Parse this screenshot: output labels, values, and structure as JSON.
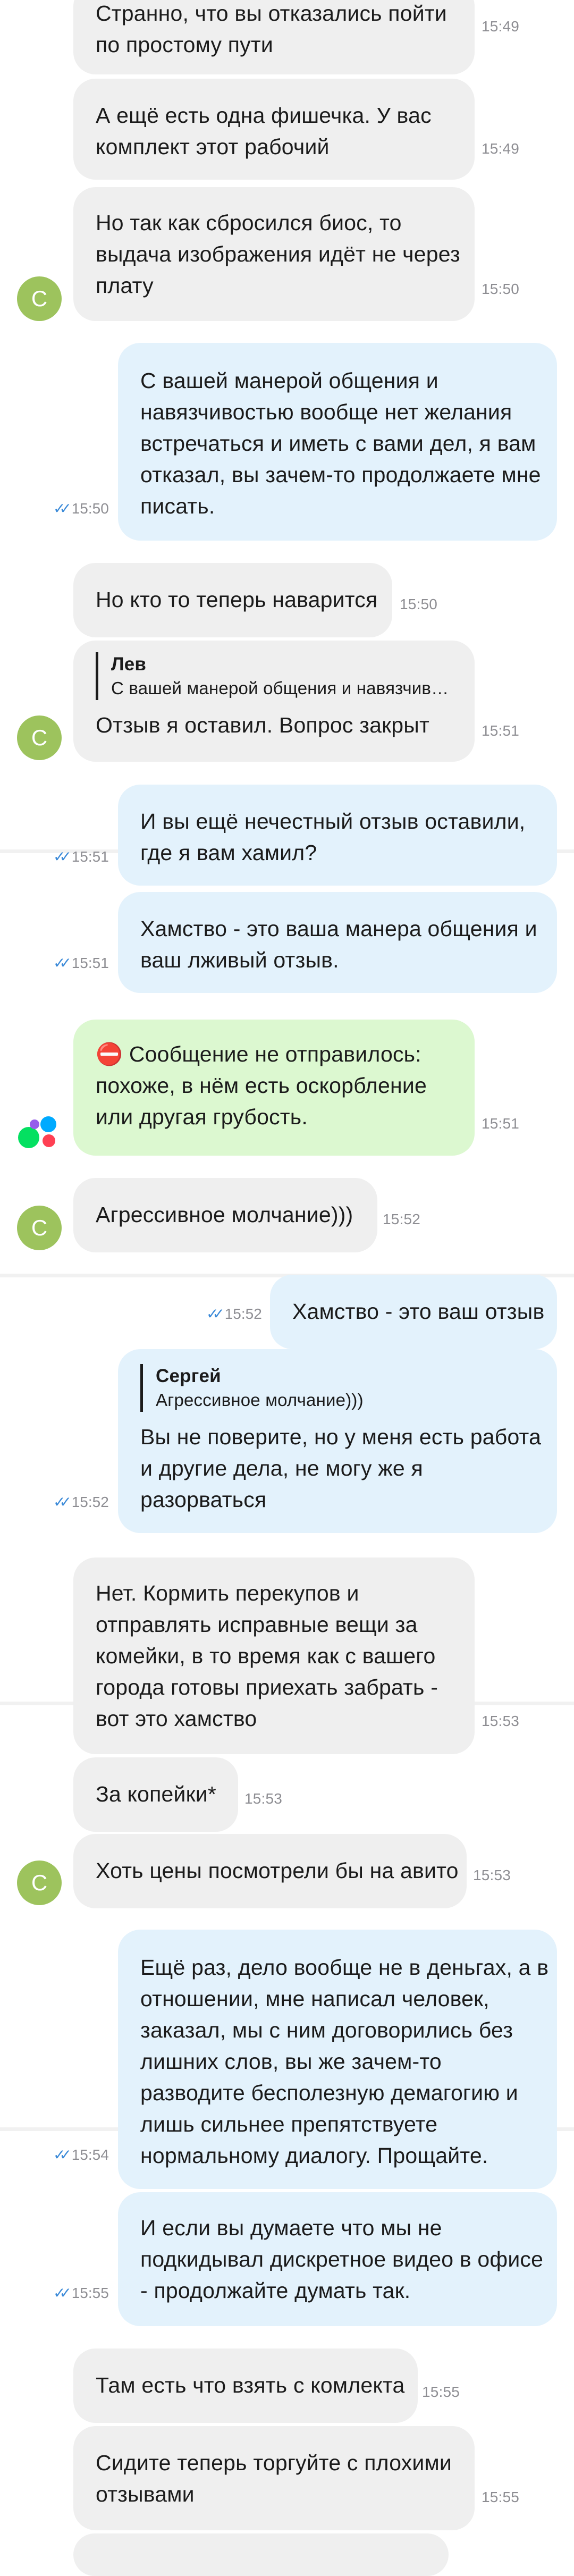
{
  "contact_a": {
    "avatar_letter": "С",
    "avatar_color": "#9dc35d"
  },
  "colors": {
    "incoming_bg": "#efefef",
    "outgoing_bg": "#e3f2fc",
    "system_bg": "#dcf8d0",
    "read_check": "#3b8ad8"
  },
  "messages": [
    {
      "dir": "in",
      "text": "Странно, что вы отказались пойти\nпо простому пути",
      "time": "15:49"
    },
    {
      "dir": "in",
      "text": "А ещё есть одна фишечка. У вас\nкомплект этот рабочий",
      "time": "15:49"
    },
    {
      "dir": "in",
      "text": "Но так как сбросился биос, то\nвыдача изображения идёт не через\nплату",
      "time": "15:50"
    },
    {
      "dir": "out",
      "text": "С вашей манерой общения и\nнавязчивостью вообще нет желания\nвстречаться и иметь с вами дел, я вам\nотказал, вы зачем-то продолжаете мне\nписать.",
      "time": "15:50",
      "check": "✓✓"
    },
    {
      "dir": "in",
      "text": "Но кто то теперь наварится",
      "time": "15:50"
    },
    {
      "dir": "in",
      "quote_author": "Лев",
      "quote_text": "С вашей манерой общения и навязчив…",
      "text": "Отзыв я оставил. Вопрос закрыт",
      "time": "15:51"
    },
    {
      "dir": "out",
      "text": "И вы ещё нечестный отзыв оставили,\nгде я вам хамил?",
      "time": "15:51",
      "check": "✓✓"
    },
    {
      "dir": "out",
      "text": "Хамство - это ваша манера общения и\nваш лживый отзыв.",
      "time": "15:51",
      "check": "✓✓"
    },
    {
      "dir": "system",
      "icon": "⛔",
      "text": "Сообщение не отправилось:\nпохоже, в нём есть оскорбление\nили другая грубость.",
      "time": "15:51"
    },
    {
      "dir": "in",
      "text": "Агрессивное молчание)))",
      "time": "15:52"
    },
    {
      "dir": "out",
      "text": "Хамство - это ваш отзыв",
      "time": "15:52",
      "check": "✓✓"
    },
    {
      "dir": "out",
      "quote_author": "Сергей",
      "quote_text": "Агрессивное молчание)))",
      "text": "Вы не поверите, но у меня есть работа\nи другие дела, не могу же я\nразорваться",
      "time": "15:52",
      "check": "✓✓"
    },
    {
      "dir": "in",
      "text": "Нет. Кормить перекупов и\nотправлять исправные вещи за\nкомейки, в то время как с вашего\nгорода готовы приехать забрать -\nвот это хамство",
      "time": "15:53"
    },
    {
      "dir": "in",
      "text": "За копейки*",
      "time": "15:53"
    },
    {
      "dir": "in",
      "text": "Хоть цены посмотрели бы на авито",
      "time": "15:53"
    },
    {
      "dir": "out",
      "text": "Ещё раз, дело вообще не в деньгах, а в\nотношении, мне написал человек,\nзаказал, мы с ним договорились без\nлишних слов, вы же зачем-то\nразводите бесполезную демагогию и\nлишь сильнее  препятствуете\nнормальному диалогу. Прощайте.",
      "time": "15:54",
      "check": "✓✓"
    },
    {
      "dir": "out",
      "text": "И если вы думаете что мы не\nподкидывал дискретное видео в офисе\n- продолжайте думать так.",
      "time": "15:55",
      "check": "✓✓"
    },
    {
      "dir": "in",
      "text": "Там есть что взять с комлекта",
      "time": "15:55"
    },
    {
      "dir": "in",
      "text": "Сидите теперь торгуйте с плохими\nотзывами",
      "time": "15:55"
    }
  ]
}
